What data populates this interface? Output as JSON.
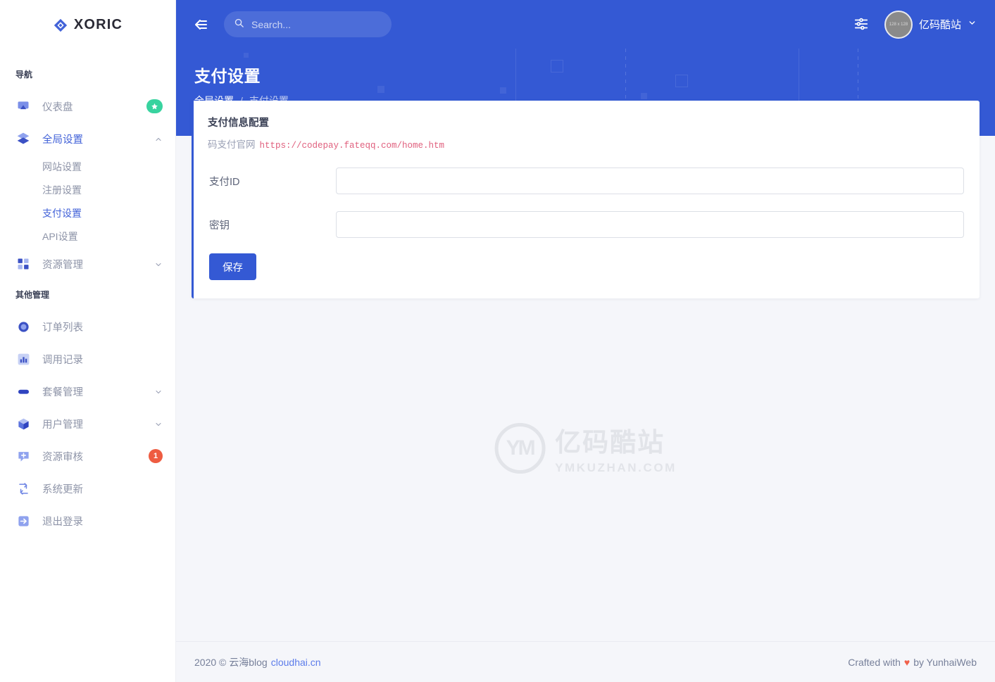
{
  "brand": {
    "name": "XORIC",
    "logo_icon": "diamond-logo-icon"
  },
  "sidebar": {
    "nav_heading": "导航",
    "other_heading": "其他管理",
    "nav_items": [
      {
        "label": "仪表盘",
        "icon": "dashboard-monitor-icon",
        "badge": "★",
        "badge_color": "#38d39f"
      },
      {
        "label": "全局设置",
        "icon": "layers-icon",
        "chevron": "chevron-up-icon",
        "active": true
      },
      {
        "label": "网站设置",
        "sub": true
      },
      {
        "label": "注册设置",
        "sub": true
      },
      {
        "label": "支付设置",
        "sub": true,
        "active": true
      },
      {
        "label": "API设置",
        "sub": true
      },
      {
        "label": "资源管理",
        "icon": "grid-squares-icon",
        "chevron": "chevron-down-icon"
      }
    ],
    "other_items": [
      {
        "label": "订单列表",
        "icon": "circle-ring-icon"
      },
      {
        "label": "调用记录",
        "icon": "bar-chart-icon"
      },
      {
        "label": "套餐管理",
        "icon": "capsule-icon",
        "chevron": "chevron-down-icon"
      },
      {
        "label": "用户管理",
        "icon": "cube-icon",
        "chevron": "chevron-down-icon"
      },
      {
        "label": "资源审核",
        "icon": "chat-plus-icon",
        "badge": "1",
        "badge_color": "#ee5c41"
      },
      {
        "label": "系统更新",
        "icon": "refresh-sync-icon"
      },
      {
        "label": "退出登录",
        "icon": "logout-arrow-icon"
      }
    ]
  },
  "topbar": {
    "collapse_icon": "collapse-left-icon",
    "search_placeholder": "Search...",
    "search_value": "",
    "search_icon": "search-icon",
    "settings_icon": "sliders-settings-icon",
    "avatar_text": "128 x 128",
    "user_name": "亿码酷站",
    "user_chevron": "chevron-down-icon"
  },
  "banner": {
    "title": "支付设置",
    "breadcrumb": {
      "parent": "全局设置",
      "separator": "/",
      "current": "支付设置"
    },
    "bg_color": "#3459d4"
  },
  "card": {
    "title": "支付信息配置",
    "sub_label": "码支付官网",
    "sub_url": "https://codepay.fateqq.com/home.htm",
    "fields": [
      {
        "label": "支付ID",
        "value": "",
        "placeholder": ""
      },
      {
        "label": "密钥",
        "value": "",
        "placeholder": ""
      }
    ],
    "save_label": "保存"
  },
  "watermark": {
    "mark": "YM",
    "cn": "亿码酷站",
    "en": "YMKUZHAN.COM"
  },
  "footer": {
    "year_copy": "2020 © 云海blog",
    "link": "cloudhai.cn",
    "crafted_prefix": "Crafted with",
    "heart": "♥",
    "crafted_suffix": "by YunhaiWeb"
  }
}
